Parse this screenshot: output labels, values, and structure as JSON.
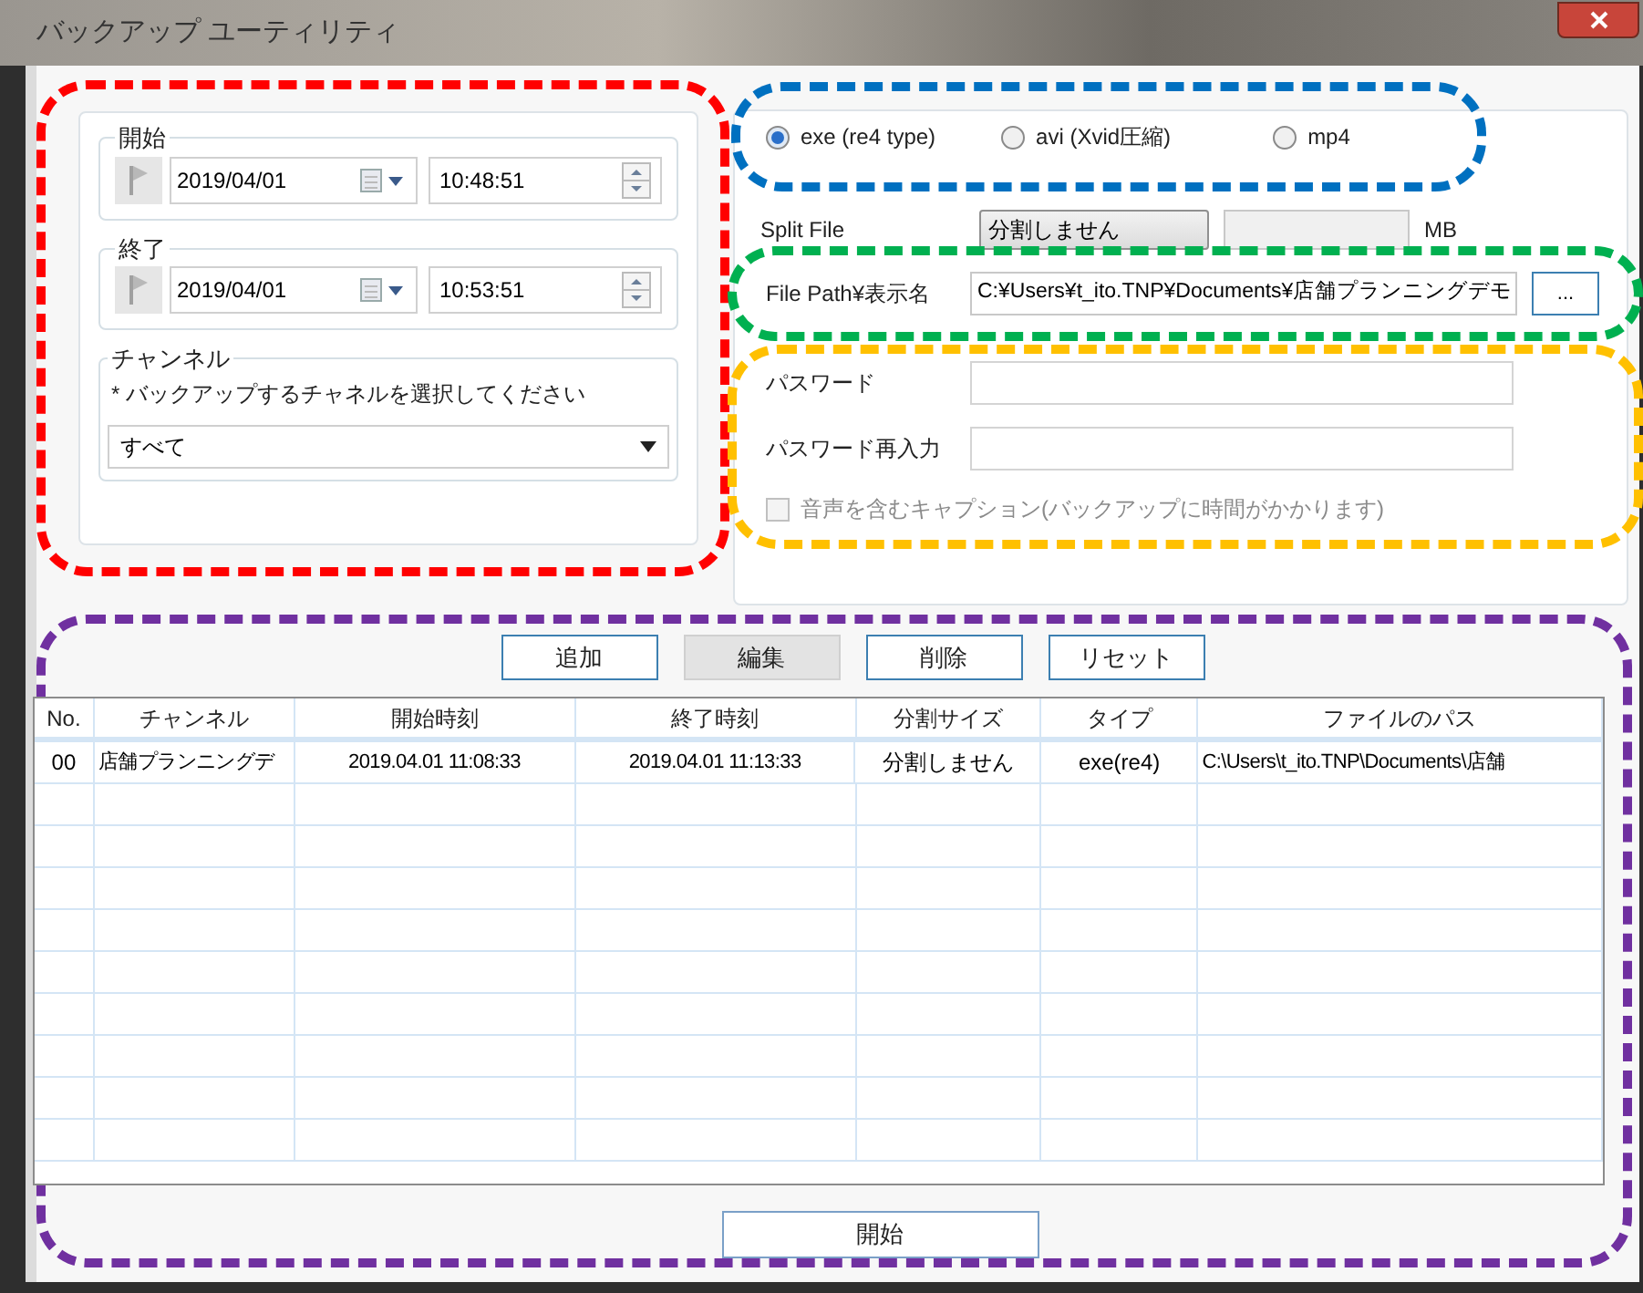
{
  "window": {
    "title": "バックアップ ユーティリティ"
  },
  "annotations": [
    {
      "color": "#ff0000"
    },
    {
      "color": "#0070c0"
    },
    {
      "color": "#00b050"
    },
    {
      "color": "#ffc000"
    },
    {
      "color": "#7030a0"
    }
  ],
  "start_group": {
    "label": "開始",
    "date": "2019/04/01",
    "time": "10:48:51"
  },
  "end_group": {
    "label": "終了",
    "date": "2019/04/01",
    "time": "10:53:51"
  },
  "channel_group": {
    "label": "チャンネル",
    "hint": "* バックアップするチャネルを選択してください",
    "value": "すべて"
  },
  "formats": [
    {
      "label": "exe (re4 type)",
      "selected": true
    },
    {
      "label": "avi (Xvid圧縮)",
      "selected": false
    },
    {
      "label": "mp4",
      "selected": false
    }
  ],
  "split": {
    "label": "Split File",
    "value": "分割しません",
    "unit": "MB"
  },
  "file_path": {
    "label": "File Path¥表示名",
    "value": "C:¥Users¥t_ito.TNP¥Documents¥店舗プランニングデモ",
    "browse": "..."
  },
  "password": {
    "label": "パスワード"
  },
  "password_confirm": {
    "label": "パスワード再入力"
  },
  "caption_option": {
    "label": "音声を含むキャプション(バックアップに時間がかかります)",
    "checked": false,
    "disabled": true
  },
  "actions": [
    {
      "label": "追加",
      "pressed": false
    },
    {
      "label": "編集",
      "pressed": true
    },
    {
      "label": "削除",
      "pressed": false
    },
    {
      "label": "リセット",
      "pressed": false
    }
  ],
  "table": {
    "columns": [
      "No.",
      "チャンネル",
      "開始時刻",
      "終了時刻",
      "分割サイズ",
      "タイプ",
      "ファイルのパス"
    ],
    "rows": [
      [
        "00",
        "店舗プランニングデ",
        "2019.04.01 11:08:33",
        "2019.04.01 11:13:33",
        "分割しません",
        "exe(re4)",
        "C:\\Users\\t_ito.TNP\\Documents\\店舗"
      ]
    ]
  },
  "start_button": "開始"
}
